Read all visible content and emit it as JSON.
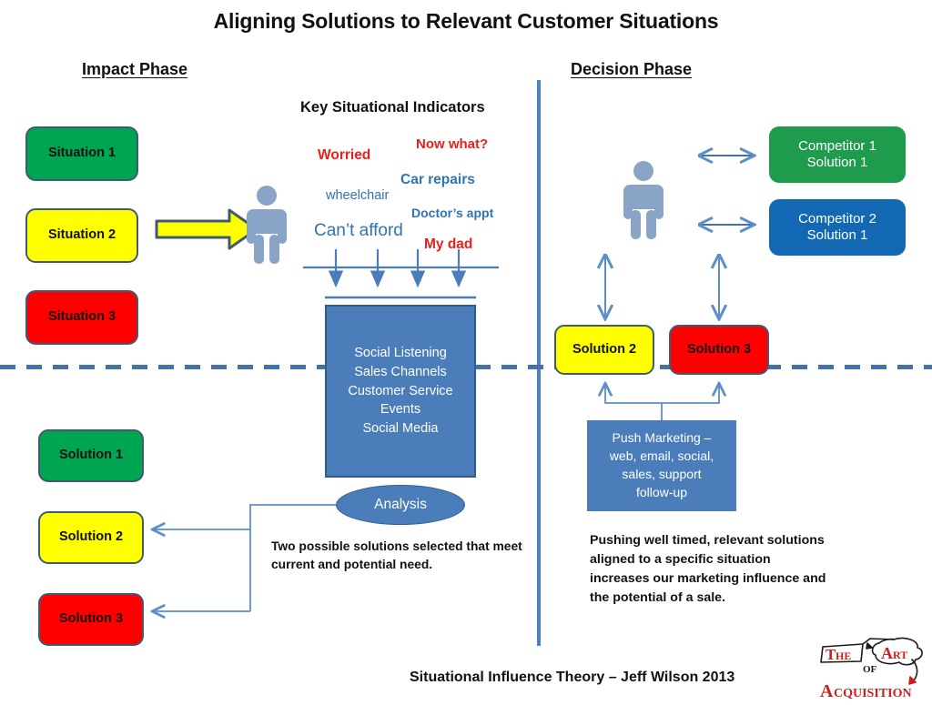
{
  "title": "Aligning Solutions to Relevant Customer Situations",
  "phases": {
    "impact": "Impact Phase",
    "decision": "Decision Phase"
  },
  "indicators_title": "Key Situational Indicators",
  "indicators": [
    {
      "text": "Worried",
      "color": "#e8201a"
    },
    {
      "text": "Now what?",
      "color": "#e8201a"
    },
    {
      "text": "Car repairs",
      "color": "#2e74b5"
    },
    {
      "text": "wheelchair",
      "color": "#2e74b5"
    },
    {
      "text": "Doctor’s appt",
      "color": "#2e74b5"
    },
    {
      "text": "Can’t afford",
      "color": "#2e74b5"
    },
    {
      "text": "My dad",
      "color": "#e8201a"
    }
  ],
  "situations": [
    {
      "label": "Situation 1",
      "color": "#00a551"
    },
    {
      "label": "Situation 2",
      "color": "#ffff00"
    },
    {
      "label": "Situation 3",
      "color": "#ff0000"
    }
  ],
  "solutions_left": [
    {
      "label": "Solution 1",
      "color": "#00a551"
    },
    {
      "label": "Solution 2",
      "color": "#ffff00"
    },
    {
      "label": "Solution 3",
      "color": "#ff0000"
    }
  ],
  "solutions_right": [
    {
      "label": "Solution 2",
      "color": "#ffff00"
    },
    {
      "label": "Solution 3",
      "color": "#ff0000"
    }
  ],
  "competitors": [
    {
      "line1": "Competitor 1",
      "line2": "Solution 1",
      "color": "#1f9b4d"
    },
    {
      "line1": "Competitor 2",
      "line2": "Solution 1",
      "color": "#1268b3"
    }
  ],
  "channels": {
    "items": [
      "Social Listening",
      "Sales Channels",
      "Customer Service",
      "Events",
      "Social Media"
    ],
    "color": "#4a7dba"
  },
  "analysis": {
    "label": "Analysis",
    "note": "Two possible solutions selected that meet current and potential need."
  },
  "push_marketing": {
    "items": [
      "Push Marketing –",
      "web, email, social,",
      "sales, support",
      "follow-up"
    ],
    "color": "#4a7dba",
    "note": "Pushing well timed, relevant solutions aligned to a specific situation increases our marketing influence and the potential of a sale."
  },
  "footer": {
    "caption": "Situational Influence Theory – Jeff Wilson 2013",
    "logo": {
      "the": "THE",
      "art": "ART",
      "of": "OF",
      "acquisition": "ACQUISITION",
      "accent": "#cc1f1f"
    }
  },
  "colors": {
    "divider_blue": "#4f81bd",
    "connector_blue": "#5b8fc9",
    "person_blue": "#8aa4c8",
    "arrow_yellow": "#ffff00",
    "arrow_outline": "#3f5b72"
  }
}
